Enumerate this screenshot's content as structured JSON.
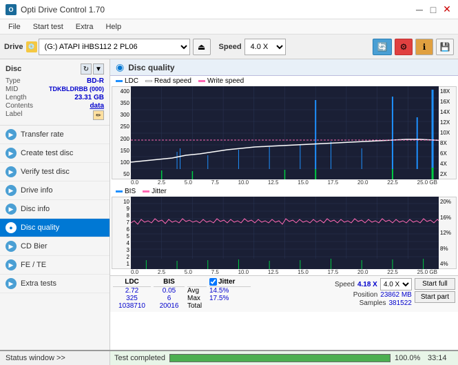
{
  "titleBar": {
    "appName": "Opti Drive Control 1.70",
    "controls": [
      "minimize",
      "maximize",
      "close"
    ]
  },
  "menuBar": {
    "items": [
      "File",
      "Start test",
      "Extra",
      "Help"
    ]
  },
  "toolbar": {
    "driveLabel": "Drive",
    "driveValue": "(G:)  ATAPI iHBS112  2 PL06",
    "speedLabel": "Speed",
    "speedValue": "4.0 X"
  },
  "sidebar": {
    "discSection": {
      "title": "Disc",
      "fields": [
        {
          "key": "Type",
          "value": "BD-R"
        },
        {
          "key": "MID",
          "value": "TDKBLDRBB (000)"
        },
        {
          "key": "Length",
          "value": "23.31 GB"
        },
        {
          "key": "Contents",
          "value": "data"
        },
        {
          "key": "Label",
          "value": ""
        }
      ]
    },
    "navItems": [
      {
        "id": "transfer-rate",
        "label": "Transfer rate",
        "active": false
      },
      {
        "id": "create-test-disc",
        "label": "Create test disc",
        "active": false
      },
      {
        "id": "verify-test-disc",
        "label": "Verify test disc",
        "active": false
      },
      {
        "id": "drive-info",
        "label": "Drive info",
        "active": false
      },
      {
        "id": "disc-info",
        "label": "Disc info",
        "active": false
      },
      {
        "id": "disc-quality",
        "label": "Disc quality",
        "active": true
      },
      {
        "id": "cd-bier",
        "label": "CD Bier",
        "active": false
      },
      {
        "id": "fe-te",
        "label": "FE / TE",
        "active": false
      },
      {
        "id": "extra-tests",
        "label": "Extra tests",
        "active": false
      }
    ]
  },
  "discQuality": {
    "title": "Disc quality",
    "legend": {
      "ldc": "LDC",
      "readSpeed": "Read speed",
      "writeSpeed": "Write speed",
      "bis": "BIS",
      "jitter": "Jitter"
    },
    "topChart": {
      "yAxisLeft": [
        "400",
        "350",
        "300",
        "250",
        "200",
        "150",
        "100",
        "50"
      ],
      "yAxisRight": [
        "18X",
        "16X",
        "14X",
        "12X",
        "10X",
        "8X",
        "6X",
        "4X",
        "2X"
      ],
      "xAxis": [
        "0.0",
        "2.5",
        "5.0",
        "7.5",
        "10.0",
        "12.5",
        "15.0",
        "17.5",
        "20.0",
        "22.5",
        "25.0 GB"
      ]
    },
    "bottomChart": {
      "yAxisLeft": [
        "10",
        "9",
        "8",
        "7",
        "6",
        "5",
        "4",
        "3",
        "2",
        "1"
      ],
      "yAxisRight": [
        "20%",
        "16%",
        "12%",
        "8%",
        "4%"
      ],
      "xAxis": [
        "0.0",
        "2.5",
        "5.0",
        "7.5",
        "10.0",
        "12.5",
        "15.0",
        "17.5",
        "20.0",
        "22.5",
        "25.0 GB"
      ]
    },
    "stats": {
      "headers": [
        "LDC",
        "BIS",
        "",
        "Jitter",
        "Speed",
        "",
        ""
      ],
      "avgLabel": "Avg",
      "avgLDC": "2.72",
      "avgBIS": "0.05",
      "avgJitter": "14.5%",
      "maxLabel": "Max",
      "maxLDC": "325",
      "maxBIS": "6",
      "maxJitter": "17.5%",
      "totalLabel": "Total",
      "totalLDC": "1038710",
      "totalBIS": "20016",
      "speedValue": "4.18 X",
      "speedSelect": "4.0 X",
      "positionLabel": "Position",
      "positionValue": "23862 MB",
      "samplesLabel": "Samples",
      "samplesValue": "381522",
      "startFullBtn": "Start full",
      "startPartBtn": "Start part",
      "jitterChecked": true
    }
  },
  "statusBar": {
    "statusWindowLabel": "Status window >>",
    "completedLabel": "Test completed",
    "progressPercent": "100.0%",
    "progressValue": 100,
    "timeValue": "33:14"
  },
  "colors": {
    "ldcLine": "#00aaff",
    "readSpeedLine": "#ffffff",
    "writeSpeedLine": "#ff69b4",
    "bisLine": "#00aaff",
    "jitterLine": "#ff69b4",
    "gridLines": "#2a3050",
    "chartBg": "#1a1f35",
    "activeNav": "#0078d4",
    "accent": "#0078d4"
  }
}
